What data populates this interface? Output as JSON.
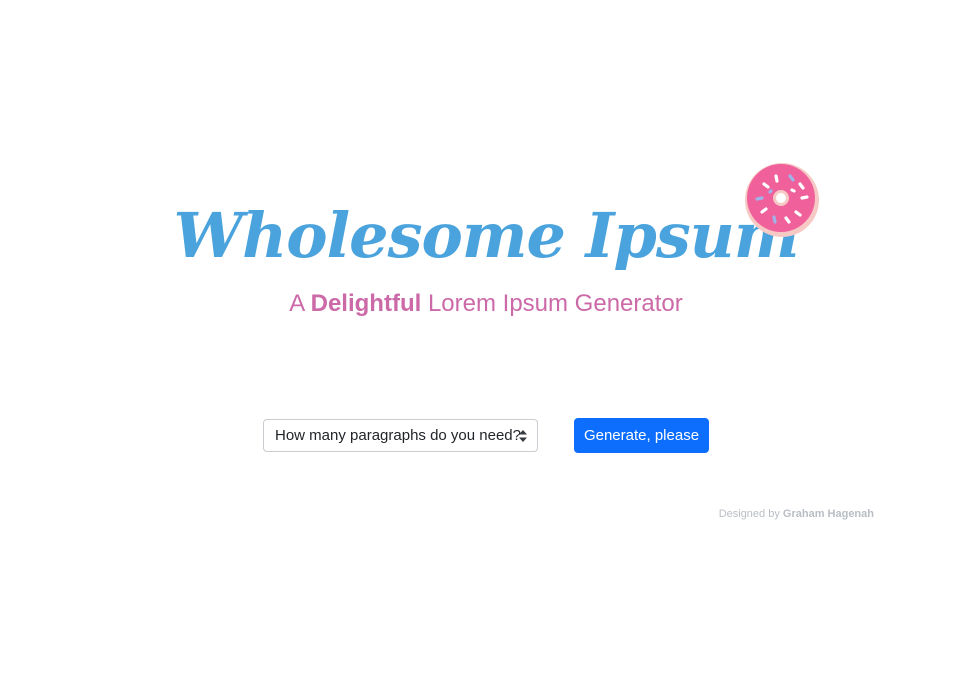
{
  "hero": {
    "title": "Wholesome Ipsum",
    "subtitle_prefix": "A",
    "subtitle_emphasis": "Delightful",
    "subtitle_suffix": "Lorem Ipsum Generator",
    "logo_icon": "donut-icon"
  },
  "form": {
    "paragraphs_select_label": "How many paragraphs do you need?",
    "generate_button_label": "Generate, please"
  },
  "footer": {
    "credit_prefix": "Designed by",
    "credit_name": "Graham Hagenah"
  },
  "colors": {
    "title": "#4aa3dc",
    "subtitle": "#cc6aa8",
    "button": "#0d6efd",
    "donut_frosting": "#f0609b",
    "donut_dough": "#f6c9c4"
  }
}
